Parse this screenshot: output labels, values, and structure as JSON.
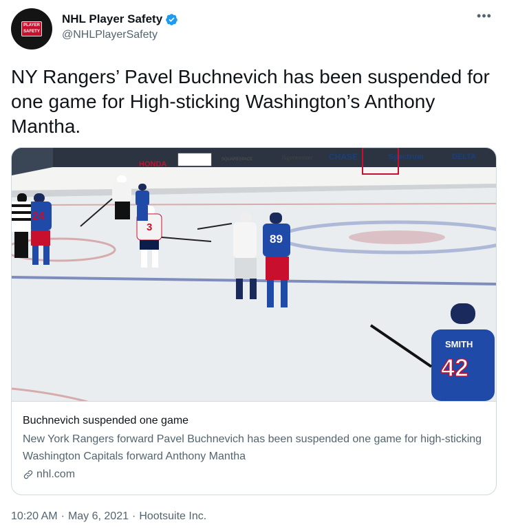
{
  "author": {
    "display_name": "NHL Player Safety",
    "handle": "@NHLPlayerSafety",
    "avatar_line1": "PLAYER",
    "avatar_line2": "SAFETY",
    "verified": true
  },
  "tweet": {
    "text": "NY Rangers’ Pavel Buchnevich has been suspended for one game for High-sticking Washington’s Anthony Mantha."
  },
  "card": {
    "image_icon": "hockey-game-photo",
    "title": "Buchnevich suspended one game",
    "description": "New York Rangers forward Pavel Buchnevich has been suspended one game for high-sticking Washington Capitals forward Anthony Mantha",
    "domain": "nhl.com",
    "photo": {
      "board_ads": [
        "HONDA",
        "SQUARESPACE",
        "Jägermeister",
        "CHASE",
        "Spectrum",
        "DELTA"
      ],
      "jersey_numbers": [
        "24",
        "3",
        "89",
        "42"
      ],
      "jersey_name": "SMITH"
    }
  },
  "meta": {
    "time": "10:20 AM",
    "date": "May 6, 2021",
    "source": "Hootsuite Inc."
  },
  "colors": {
    "verified": "#1d9bf0",
    "rangers_blue": "#1f4aa8",
    "rangers_red": "#c8102e",
    "text_secondary": "#536471"
  }
}
